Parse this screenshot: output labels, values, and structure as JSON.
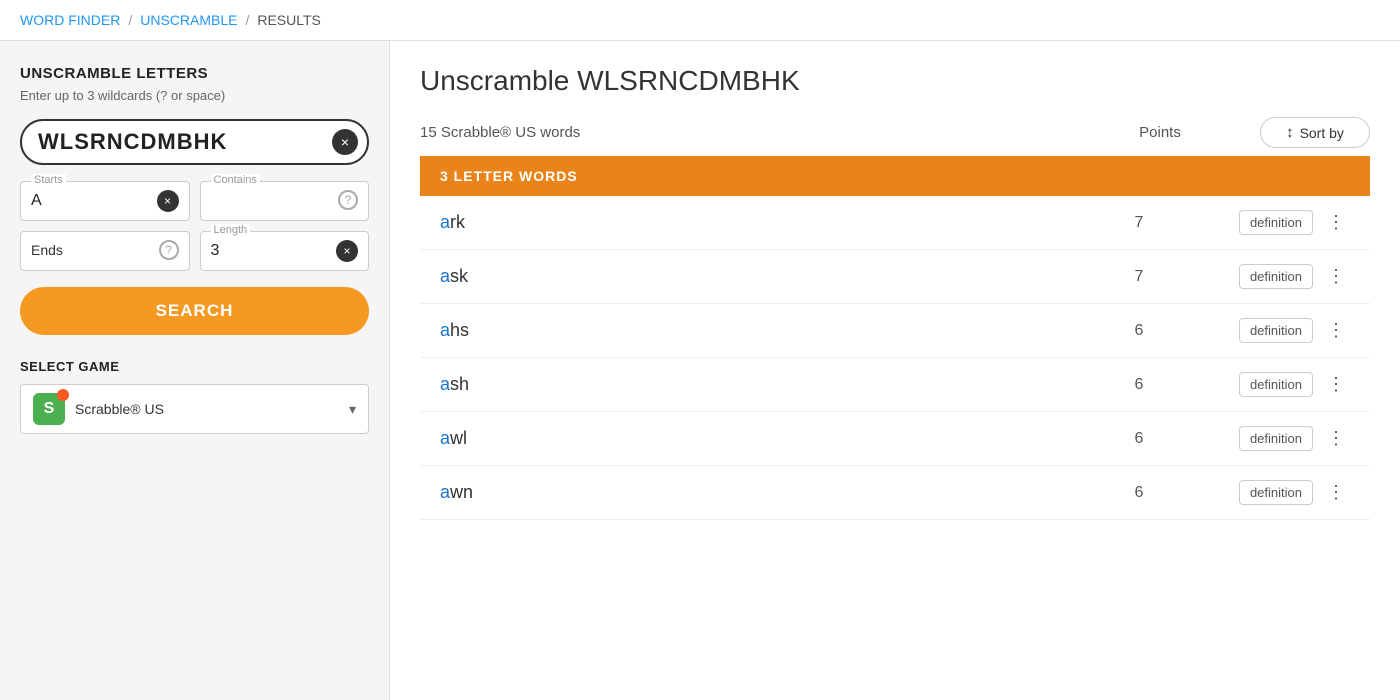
{
  "breadcrumb": {
    "items": [
      {
        "label": "WORD FINDER",
        "link": true
      },
      {
        "label": "UNSCRAMBLE",
        "link": true
      },
      {
        "label": "RESULTS",
        "link": false
      }
    ]
  },
  "sidebar": {
    "title": "UNSCRAMBLE LETTERS",
    "subtitle": "Enter up to 3 wildcards (? or space)",
    "search_value": "WLSRNCDMBHK",
    "clear_btn_label": "×",
    "starts_label": "Starts",
    "starts_value": "A",
    "contains_label": "Contains",
    "contains_placeholder": "",
    "ends_label": "Ends",
    "length_label": "Length",
    "length_value": "3",
    "search_btn": "SEARCH",
    "select_game_title": "SELECT GAME",
    "game_name": "Scrabble® US",
    "chevron": "▾"
  },
  "results": {
    "title": "Unscramble WLSRNCDMBHK",
    "count_text": "15 Scrabble® US words",
    "points_label": "Points",
    "sort_label": "Sort by",
    "section_label": "3 LETTER WORDS",
    "words": [
      {
        "word": "ark",
        "first": "a",
        "rest": "rk",
        "points": 7
      },
      {
        "word": "ask",
        "first": "a",
        "rest": "sk",
        "points": 7
      },
      {
        "word": "ahs",
        "first": "a",
        "rest": "hs",
        "points": 6
      },
      {
        "word": "ash",
        "first": "a",
        "rest": "sh",
        "points": 6
      },
      {
        "word": "awl",
        "first": "a",
        "rest": "wl",
        "points": 6
      },
      {
        "word": "awn",
        "first": "a",
        "rest": "wn",
        "points": 6
      }
    ],
    "definition_btn_label": "definition",
    "more_btn_label": "⋮"
  }
}
